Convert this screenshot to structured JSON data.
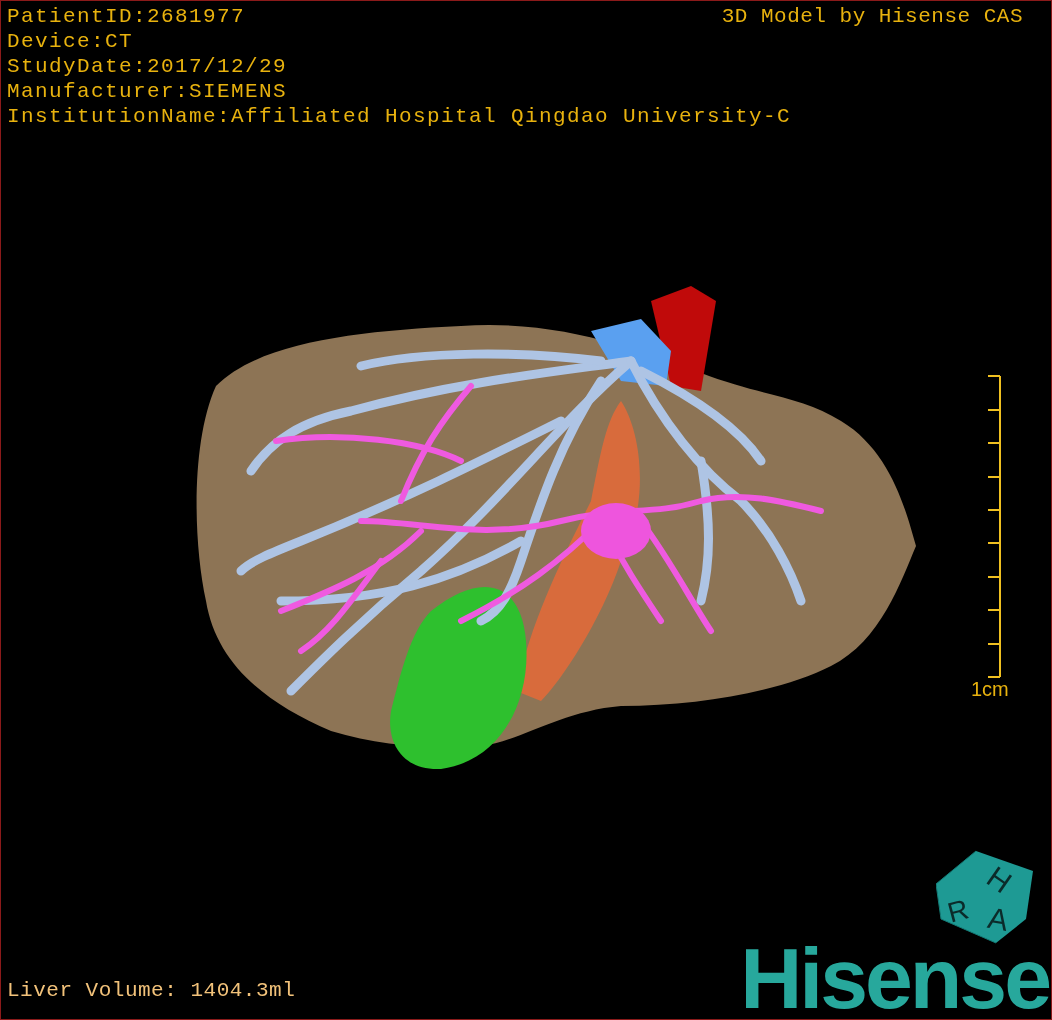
{
  "info_lines": [
    "PatientID:2681977",
    "Device:CT",
    "StudyDate:2017/12/29",
    "Manufacturer:SIEMENS",
    "InstitutionName:Affiliated Hospital Qingdao University-C"
  ],
  "title": "3D Model by Hisense CAS",
  "scale_bar": {
    "label": "1cm"
  },
  "orientation_cube": {
    "labels": [
      "H",
      "R",
      "A"
    ]
  },
  "logo": "Hisense",
  "liver_volume": "Liver Volume: 1404.3ml"
}
